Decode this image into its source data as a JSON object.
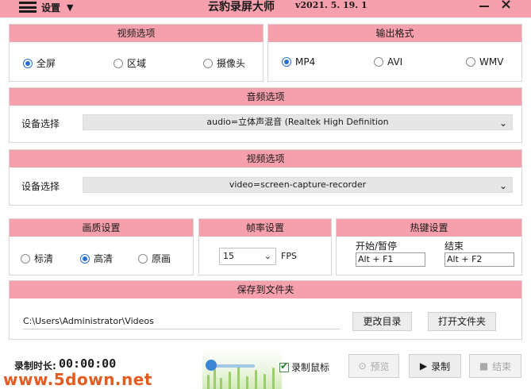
{
  "titlebar": {
    "menu_label": "设置",
    "title": "云豹录屏大师",
    "version": "v2021. 5. 19. 1",
    "close_glyph": "×",
    "menu_icon": "hamburger-icon"
  },
  "video_options": {
    "title": "视频选项",
    "options": [
      "全屏",
      "区域",
      "摄像头"
    ],
    "selected": "全屏"
  },
  "output_format": {
    "title": "输出格式",
    "options": [
      "MP4",
      "AVI",
      "WMV"
    ],
    "selected": "MP4"
  },
  "audio_options": {
    "title": "音频选项",
    "device_label": "设备选择",
    "device_value": "audio=立体声混音 (Realtek High Definition"
  },
  "video_device": {
    "title": "视频选项",
    "device_label": "设备选择",
    "device_value": "video=screen-capture-recorder"
  },
  "quality": {
    "title": "画质设置",
    "options": [
      "标清",
      "高清",
      "原画"
    ],
    "selected": "高清"
  },
  "framerate": {
    "title": "帧率设置",
    "value": "15",
    "unit": "FPS"
  },
  "hotkeys": {
    "title": "热键设置",
    "start_label": "开始/暂停",
    "start_value": "Alt + F1",
    "stop_label": "结束",
    "stop_value": "Alt + F2"
  },
  "save_folder": {
    "title": "保存到文件夹",
    "path": "C:\\Users\\Administrator\\Videos",
    "change_button": "更改目录",
    "open_button": "打开文件夹"
  },
  "bottom": {
    "rec_time_label": "录制时长:",
    "rec_time": "00:00:00",
    "record_mouse_label": "录制鼠标",
    "record_mouse_checked": true,
    "preview_label": "预览",
    "record_label": "录制",
    "stop_label": "结束",
    "watermark": "www.5down.net"
  },
  "colors": {
    "header_pink": "#f7a0ad",
    "accent_blue": "#2a6fd0",
    "watermark_orange": "#e55a1e"
  }
}
